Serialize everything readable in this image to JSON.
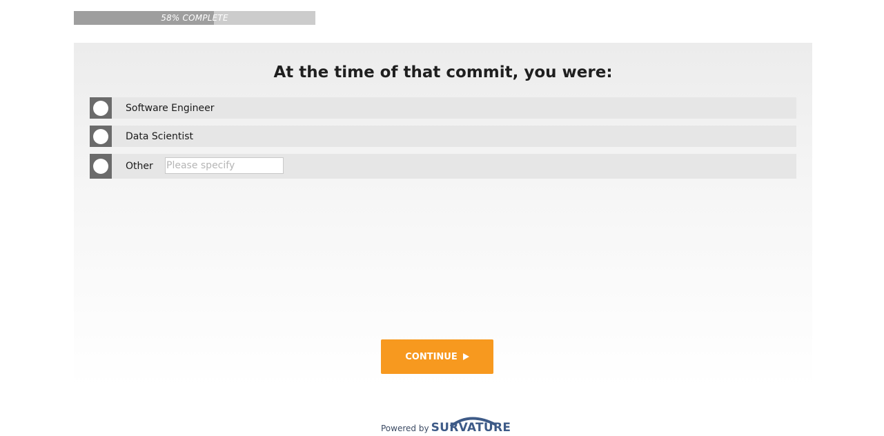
{
  "progress": {
    "label": "58% COMPLETE",
    "fraction": 0.58
  },
  "question": {
    "title": "At the time of that commit, you were:"
  },
  "options": [
    {
      "label": "Software Engineer"
    },
    {
      "label": "Data Scientist"
    },
    {
      "label": "Other",
      "specify_placeholder": "Please specify",
      "specify_value": ""
    }
  ],
  "continue_button": {
    "label": "CONTINUE",
    "icon": "play-triangle-icon"
  },
  "footer": {
    "powered_by": "Powered by",
    "brand": "SURVATURE"
  },
  "colors": {
    "accent": "#f7991f",
    "radio_box": "#6b6b6b",
    "option_bg": "#e6e6e6",
    "brand": "#3d5a87"
  }
}
